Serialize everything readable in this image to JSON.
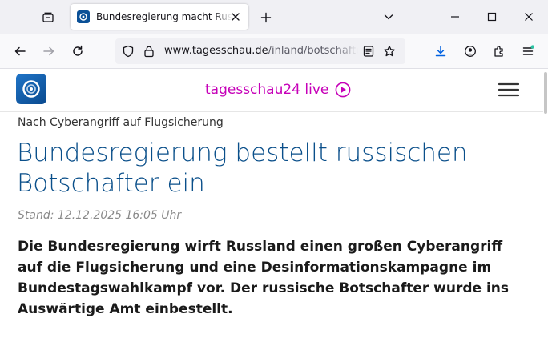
{
  "browser": {
    "tab": {
      "title": "Bundesregierung macht Russland"
    },
    "url": {
      "host": "www.tagesschau.de",
      "path": "/inland/botschafter"
    }
  },
  "site": {
    "live_label": "tagesschau24 live"
  },
  "article": {
    "topline": "Nach Cyberangriff auf Flugsicherung",
    "headline": "Bundesregierung bestellt russischen Botschafter ein",
    "stand": "Stand: 12.12.2025 16:05 Uhr",
    "lead": "Die Bundesregierung wirft Russland einen großen Cyberangriff auf die Flugsicherung und eine Desinformationskampagne im Bundestagswahlkampf vor. Der russische Botschafter wurde ins Auswärtige Amt einbestellt."
  },
  "colors": {
    "brand_blue": "#0a4f8a",
    "live_magenta": "#c600b8"
  },
  "icons": {
    "tab_list": "tab-list-icon",
    "close": "close-icon",
    "new_tab": "plus-icon",
    "chevron": "chevron-down-icon",
    "back": "arrow-left-icon",
    "forward": "arrow-right-icon",
    "reload": "reload-icon",
    "shield": "shield-icon",
    "lock": "lock-icon",
    "reader": "reader-view-icon",
    "bookmark": "star-icon",
    "downloads": "download-icon",
    "account": "account-icon",
    "extensions": "puzzle-icon",
    "menu": "hamburger-icon",
    "play": "play-icon"
  }
}
